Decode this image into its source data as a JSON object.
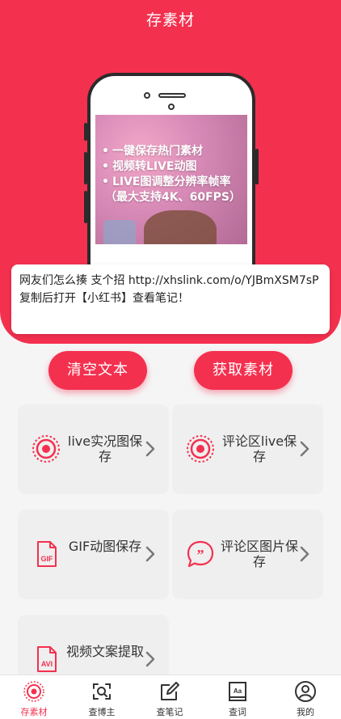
{
  "header": {
    "title": "存素材"
  },
  "phone_screen": {
    "features": [
      "一键保存热门素材",
      "视频转LIVE动图",
      "LIVE图调整分辨率帧率"
    ],
    "features_note": "（最大支持4K、60FPS）"
  },
  "link_input": {
    "value_line1": "网友们怎么揍 支个招 http://xhslink.com/o/YJBmXSM7sP",
    "value_line2": "复制后打开【小红书】查看笔记！"
  },
  "actions": {
    "clear_label": "清空文本",
    "get_label": "获取素材"
  },
  "cards": [
    {
      "label": "live实况图保存",
      "icon": "live-photo-icon"
    },
    {
      "label": "评论区live保存",
      "icon": "live-photo-icon"
    },
    {
      "label": "GIF动图保存",
      "icon": "gif-file-icon"
    },
    {
      "label": "评论区图片保存",
      "icon": "quote-bubble-icon"
    },
    {
      "label": "视频文案提取",
      "icon": "avi-file-icon"
    }
  ],
  "tabbar": [
    {
      "label": "存素材",
      "icon": "live-photo-icon",
      "active": true
    },
    {
      "label": "查博主",
      "icon": "scan-search-icon"
    },
    {
      "label": "查笔记",
      "icon": "edit-note-icon"
    },
    {
      "label": "查词",
      "icon": "dictionary-icon"
    },
    {
      "label": "我的",
      "icon": "user-icon"
    }
  ],
  "colors": {
    "accent": "#f4304f",
    "card_bg": "#efefef",
    "page_bg": "#f5f5f5"
  }
}
